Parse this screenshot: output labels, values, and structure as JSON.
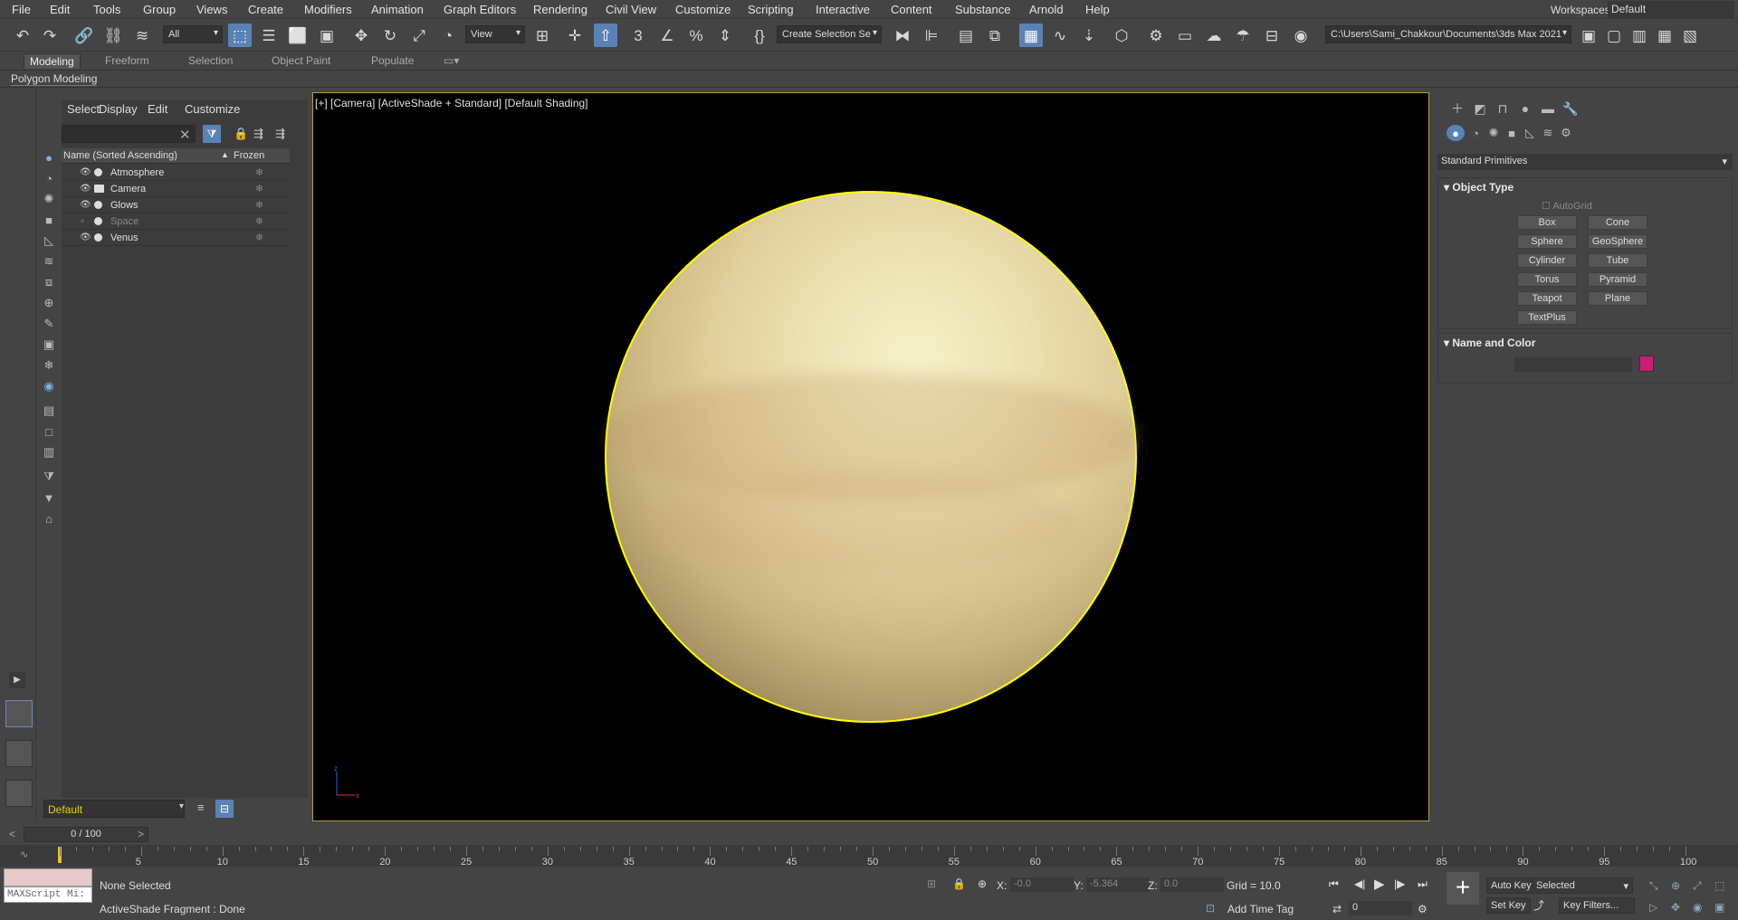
{
  "menu": [
    "File",
    "Edit",
    "Tools",
    "Group",
    "Views",
    "Create",
    "Modifiers",
    "Animation",
    "Graph Editors",
    "Rendering",
    "Civil View",
    "Customize",
    "Scripting",
    "Interactive",
    "Content",
    "Substance",
    "Arnold",
    "Help"
  ],
  "workspace": {
    "label": "Workspaces:",
    "value": "Default"
  },
  "toolbar": {
    "filter_value": "All",
    "refcoord_value": "View",
    "selection_set_placeholder": "Create Selection Se",
    "path": "C:\\Users\\Sami_Chakkour\\Documents\\3ds Max 2021"
  },
  "ribbon_tabs": [
    "Modeling",
    "Freeform",
    "Selection",
    "Object Paint",
    "Populate"
  ],
  "ribbon_panel": "Polygon Modeling",
  "explorer": {
    "menu": [
      "Select",
      "Display",
      "Edit",
      "Customize"
    ],
    "col_name": "Name (Sorted Ascending)",
    "col_frozen": "Frozen",
    "rows": [
      {
        "name": "Atmosphere",
        "hidden": false
      },
      {
        "name": "Camera",
        "hidden": false
      },
      {
        "name": "Glows",
        "hidden": false
      },
      {
        "name": "Space",
        "hidden": true
      },
      {
        "name": "Venus",
        "hidden": false
      }
    ],
    "layer": "Default"
  },
  "viewport": {
    "label": "[+] [Camera] [ActiveShade + Standard] [Default Shading]"
  },
  "command_panel": {
    "category": "Standard Primitives",
    "object_type_title": "Object Type",
    "autogrid": "AutoGrid",
    "buttons": [
      "Box",
      "Cone",
      "Sphere",
      "GeoSphere",
      "Cylinder",
      "Tube",
      "Torus",
      "Pyramid",
      "Teapot",
      "Plane",
      "TextPlus"
    ],
    "name_color_title": "Name and Color",
    "swatch_color": "#c81e78"
  },
  "timeline": {
    "frame": "0 / 100",
    "ticks": [
      "5",
      "10",
      "15",
      "20",
      "25",
      "30",
      "35",
      "40",
      "45",
      "50",
      "55",
      "60",
      "65",
      "70",
      "75",
      "80",
      "85",
      "90",
      "95",
      "100"
    ]
  },
  "status": {
    "maxscript": "MAXScript Mi:",
    "selection": "None Selected",
    "prompt": "ActiveShade Fragment : Done",
    "x_label": "X:",
    "x_value": "-0.0",
    "y_label": "Y:",
    "y_value": "-5.364",
    "z_label": "Z:",
    "z_value": "0.0",
    "grid": "Grid = 10.0",
    "add_time_tag": "Add Time Tag",
    "auto_key": "Auto Key",
    "set_key": "Set Key",
    "selected": "Selected",
    "key_filters": "Key Filters...",
    "frame_field": "0"
  }
}
